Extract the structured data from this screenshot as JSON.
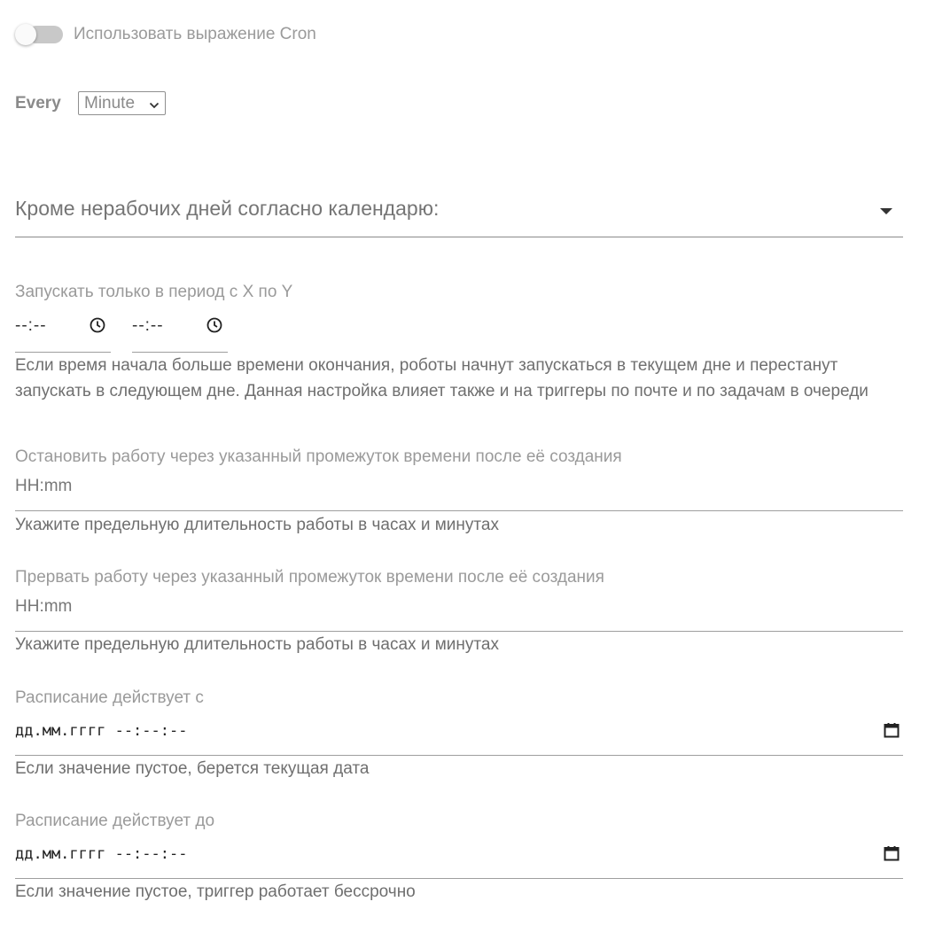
{
  "cron_toggle": {
    "label": "Использовать выражение Cron"
  },
  "every": {
    "label": "Every",
    "selected": "Minute"
  },
  "calendar_select": {
    "placeholder": "Кроме нерабочих дней согласно календарю:"
  },
  "period": {
    "label": "Запускать только в период с X по Y",
    "from_value": "--:--",
    "to_value": "--:--",
    "helper": "Если время начала больше времени окончания, роботы начнут запускаться в текущем дне и перестанут запускать в следующем дне. Данная настройка влияет также и на триггеры по почте и по задачам в очереди"
  },
  "stop_after": {
    "label": "Остановить работу через указанный промежуток времени после её создания",
    "placeholder": "HH:mm",
    "helper": "Укажите предельную длительность работы в часах и минутах"
  },
  "abort_after": {
    "label": "Прервать работу через указанный промежуток времени после её создания",
    "placeholder": "HH:mm",
    "helper": "Укажите предельную длительность работы в часах и минутах"
  },
  "valid_from": {
    "label": "Расписание действует с",
    "value": "дд.мм.гггг --:--:--",
    "helper": "Если значение пустое, берется текущая дата"
  },
  "valid_to": {
    "label": "Расписание действует до",
    "value": "дд.мм.гггг --:--:--",
    "helper": "Если значение пустое, триггер работает бессрочно"
  },
  "icons": {
    "clock": "clock-icon",
    "calendar": "calendar-icon",
    "dropdown": "dropdown-arrow-icon"
  }
}
